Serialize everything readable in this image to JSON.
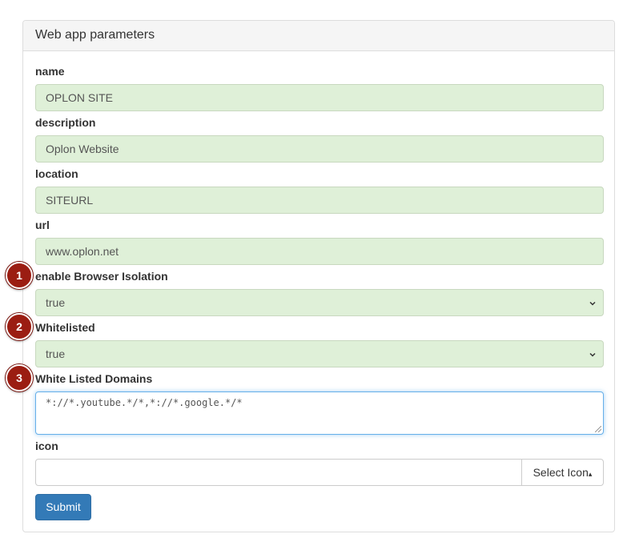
{
  "panel": {
    "title": "Web app parameters"
  },
  "fields": {
    "name": {
      "label": "name",
      "value": "OPLON SITE"
    },
    "description": {
      "label": "description",
      "value": "Oplon Website"
    },
    "location": {
      "label": "location",
      "value": "SITEURL"
    },
    "url": {
      "label": "url",
      "value": "www.oplon.net"
    },
    "browser_isolation": {
      "label": "enable Browser Isolation",
      "value": "true"
    },
    "whitelisted": {
      "label": "Whitelisted",
      "value": "true"
    },
    "whitelisted_domains": {
      "label": "White Listed Domains",
      "value": "*://*.youtube.*/*,*://*.google.*/*"
    },
    "icon": {
      "label": "icon",
      "value": "",
      "button_label": "Select Icon",
      "button_caret": "▴"
    }
  },
  "submit_label": "Submit",
  "badges": [
    "1",
    "2",
    "3"
  ],
  "icons": {
    "chevron": "chevron-down-icon",
    "caret": "caret-up-icon"
  },
  "colors": {
    "success_bg": "#dff0d8",
    "primary": "#337ab7",
    "badge": "#9b1d12"
  }
}
